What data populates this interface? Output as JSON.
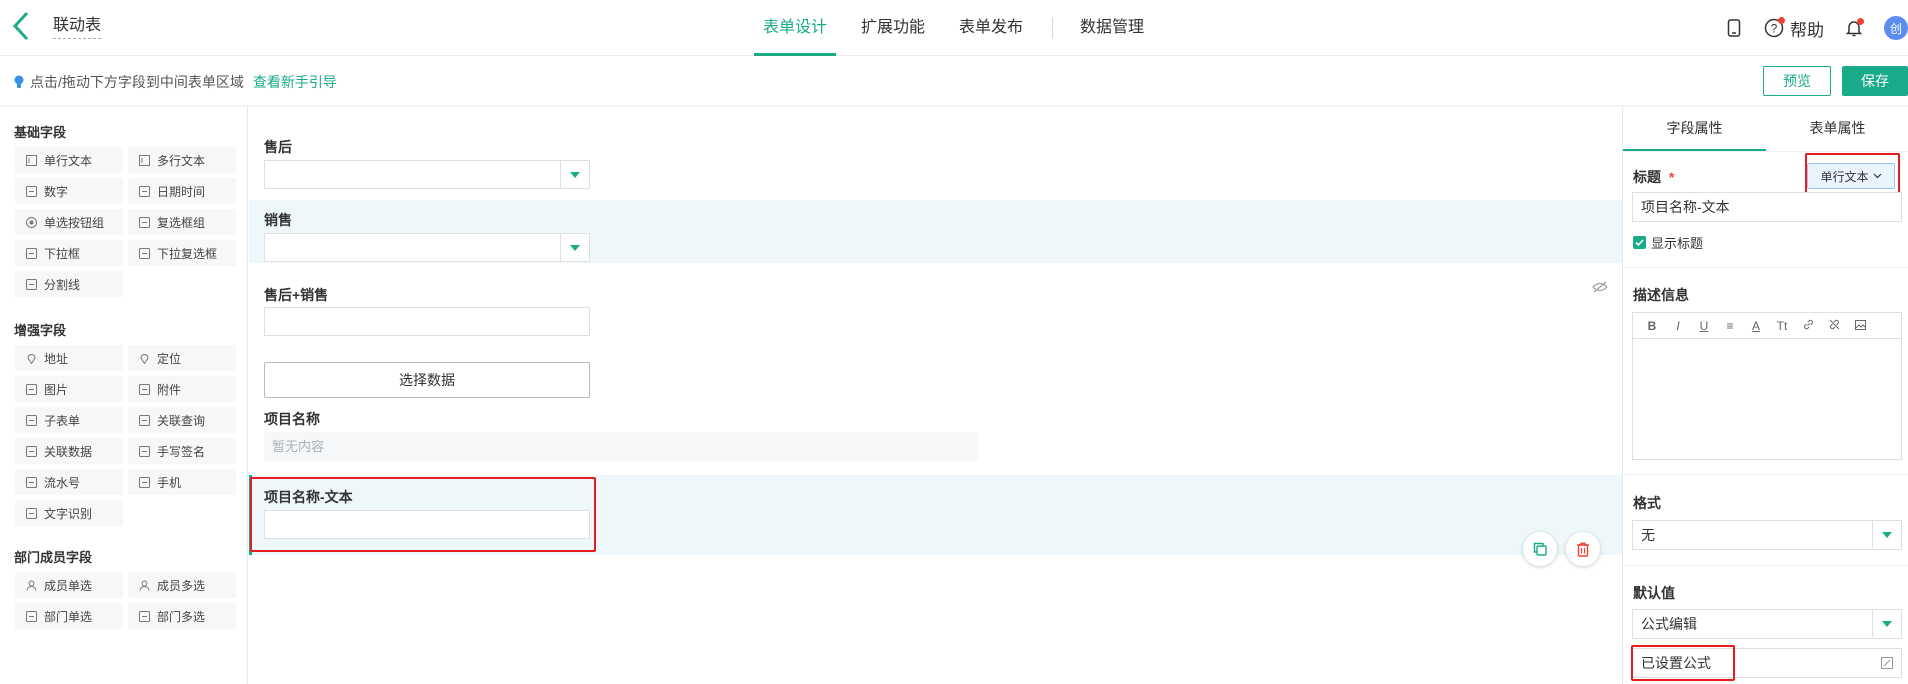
{
  "header": {
    "title": "联动表",
    "tabs": [
      {
        "label": "表单设计",
        "active": true
      },
      {
        "label": "扩展功能",
        "active": false
      },
      {
        "label": "表单发布",
        "active": false
      },
      {
        "label": "数据管理",
        "active": false
      }
    ],
    "help_label": "帮助",
    "avatar_text": "创"
  },
  "subbar": {
    "hint": "点击/拖动下方字段到中间表单区域",
    "hint_link": "查看新手引导",
    "preview_label": "预览",
    "save_label": "保存"
  },
  "left": {
    "basic_title": "基础字段",
    "basic_fields": [
      "单行文本",
      "多行文本",
      "数字",
      "日期时间",
      "单选按钮组",
      "复选框组",
      "下拉框",
      "下拉复选框",
      "分割线"
    ],
    "enhanced_title": "增强字段",
    "enhanced_fields": [
      "地址",
      "定位",
      "图片",
      "附件",
      "子表单",
      "关联查询",
      "关联数据",
      "手写签名",
      "流水号",
      "手机",
      "文字识别"
    ],
    "member_title": "部门成员字段",
    "member_fields": [
      "成员单选",
      "成员多选",
      "部门单选",
      "部门多选"
    ]
  },
  "canvas": {
    "f1_label": "售后",
    "f2_label": "销售",
    "f3_label": "售后+销售",
    "select_data_label": "选择数据",
    "f4_label": "项目名称",
    "f4_placeholder": "暂无内容",
    "f5_label": "项目名称-文本"
  },
  "right": {
    "tab_field": "字段属性",
    "tab_form": "表单属性",
    "title_label": "标题",
    "required_mark": "*",
    "type_label": "单行文本",
    "title_value": "项目名称-文本",
    "show_title_label": "显示标题",
    "desc_label": "描述信息",
    "editor_tools": [
      "B",
      "I",
      "U",
      "≡",
      "A",
      "Tt",
      "link-icon",
      "unlink-icon",
      "image-icon"
    ],
    "format_label": "格式",
    "format_value": "无",
    "default_label": "默认值",
    "default_mode": "公式编辑",
    "formula_value": "已设置公式"
  },
  "colors": {
    "accent": "#1aab8a",
    "highlight_row": "#eef8fb",
    "annotation_red": "#e81c1c"
  }
}
